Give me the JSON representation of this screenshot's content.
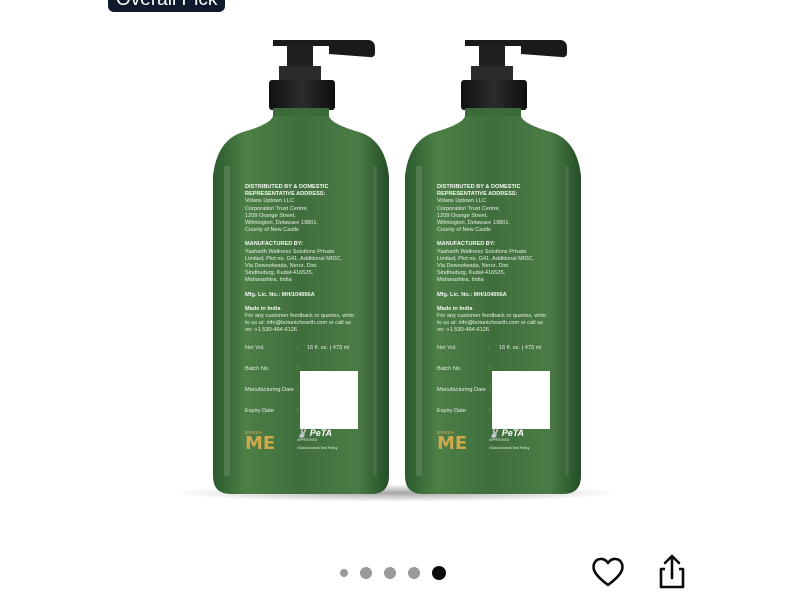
{
  "badge": {
    "text": "Overall Pick"
  },
  "bottle_label": {
    "distributor_heading": "DISTRIBUTED BY & DOMESTIC REPRESENTATIVE ADDRESS:",
    "distributor_lines": [
      "Volans Uptown LLC",
      "Corporation Trust Centre,",
      "1209 Orange Street,",
      "Wilmington, Delaware 19801,",
      "County of New Castle"
    ],
    "manufacturer_heading": "MANUFACTURED BY:",
    "manufacturer_lines": [
      "Yasharth Wellness Solutions Private",
      "Limited, Plot no. G41, Additional MIDC,",
      "Via Dewoolwada, Nerur, Dist.",
      "Sindhudurg, Kudal-416525,",
      "Maharashtra, India"
    ],
    "license": "Mfg. Lic. No.: MH/104056A",
    "made_in": "Made in India",
    "feedback_lines": [
      "For any customer feedback or queries, write",
      "to us at: info@botanichearth.com or call us",
      "on: +1 530-464-6126"
    ],
    "net_vol_label": "Net Vol.",
    "net_vol_value": "16 fl. oz. | 473 ml",
    "batch_label": "Batch No.",
    "mfg_date_label": "Manufacturing Date",
    "expiry_label": "Expiry Date",
    "brand_small": "BRND•",
    "brand": "ME",
    "peta": "PeTA",
    "peta_approved": "APPROVED",
    "peta_sub": "Global Animal Test Policy"
  },
  "carousel": {
    "count": 5,
    "active_index": 4
  },
  "actions": {
    "favorite_icon": "heart-icon",
    "share_icon": "share-icon"
  }
}
